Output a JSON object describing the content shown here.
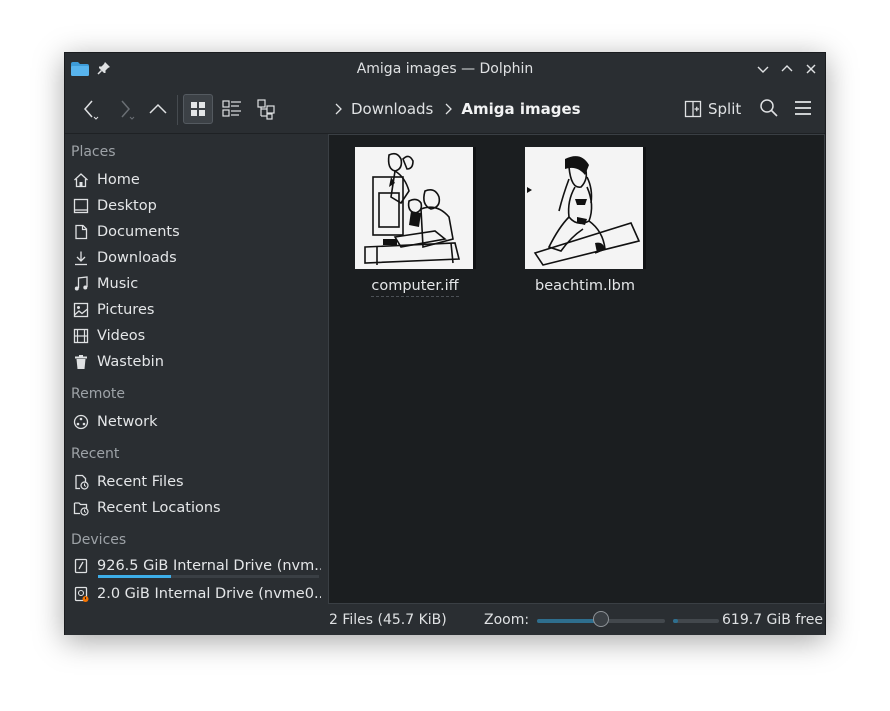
{
  "window": {
    "title": "Amiga images — Dolphin"
  },
  "breadcrumb": {
    "items": [
      "Downloads",
      "Amiga images"
    ]
  },
  "toolbar": {
    "split_label": "Split"
  },
  "sidebar": {
    "places_title": "Places",
    "places": [
      {
        "label": "Home",
        "icon": "home-icon"
      },
      {
        "label": "Desktop",
        "icon": "desktop-icon"
      },
      {
        "label": "Documents",
        "icon": "documents-icon"
      },
      {
        "label": "Downloads",
        "icon": "downloads-icon"
      },
      {
        "label": "Music",
        "icon": "music-icon"
      },
      {
        "label": "Pictures",
        "icon": "pictures-icon"
      },
      {
        "label": "Videos",
        "icon": "videos-icon"
      },
      {
        "label": "Wastebin",
        "icon": "wastebin-icon"
      }
    ],
    "remote_title": "Remote",
    "remote": [
      {
        "label": "Network",
        "icon": "network-icon"
      }
    ],
    "recent_title": "Recent",
    "recent": [
      {
        "label": "Recent Files",
        "icon": "recent-files-icon"
      },
      {
        "label": "Recent Locations",
        "icon": "recent-locations-icon"
      }
    ],
    "devices_title": "Devices",
    "devices": [
      {
        "label": "926.5 GiB Internal Drive (nvm...",
        "icon": "drive-icon",
        "usage_percent": 33
      },
      {
        "label": "2.0 GiB Internal Drive (nvme0...",
        "icon": "drive-warning-icon"
      }
    ]
  },
  "files": [
    {
      "name": "computer.iff"
    },
    {
      "name": "beachtim.lbm"
    }
  ],
  "status": {
    "summary": "2 Files (45.7 KiB)",
    "zoom_label": "Zoom:",
    "zoom_percent": 50,
    "free_space": "619.7 GiB free",
    "free_bar_percent": 10
  },
  "colors": {
    "window_bg": "#2a2e32",
    "content_bg": "#1b1e20",
    "accent": "#3daee9"
  }
}
